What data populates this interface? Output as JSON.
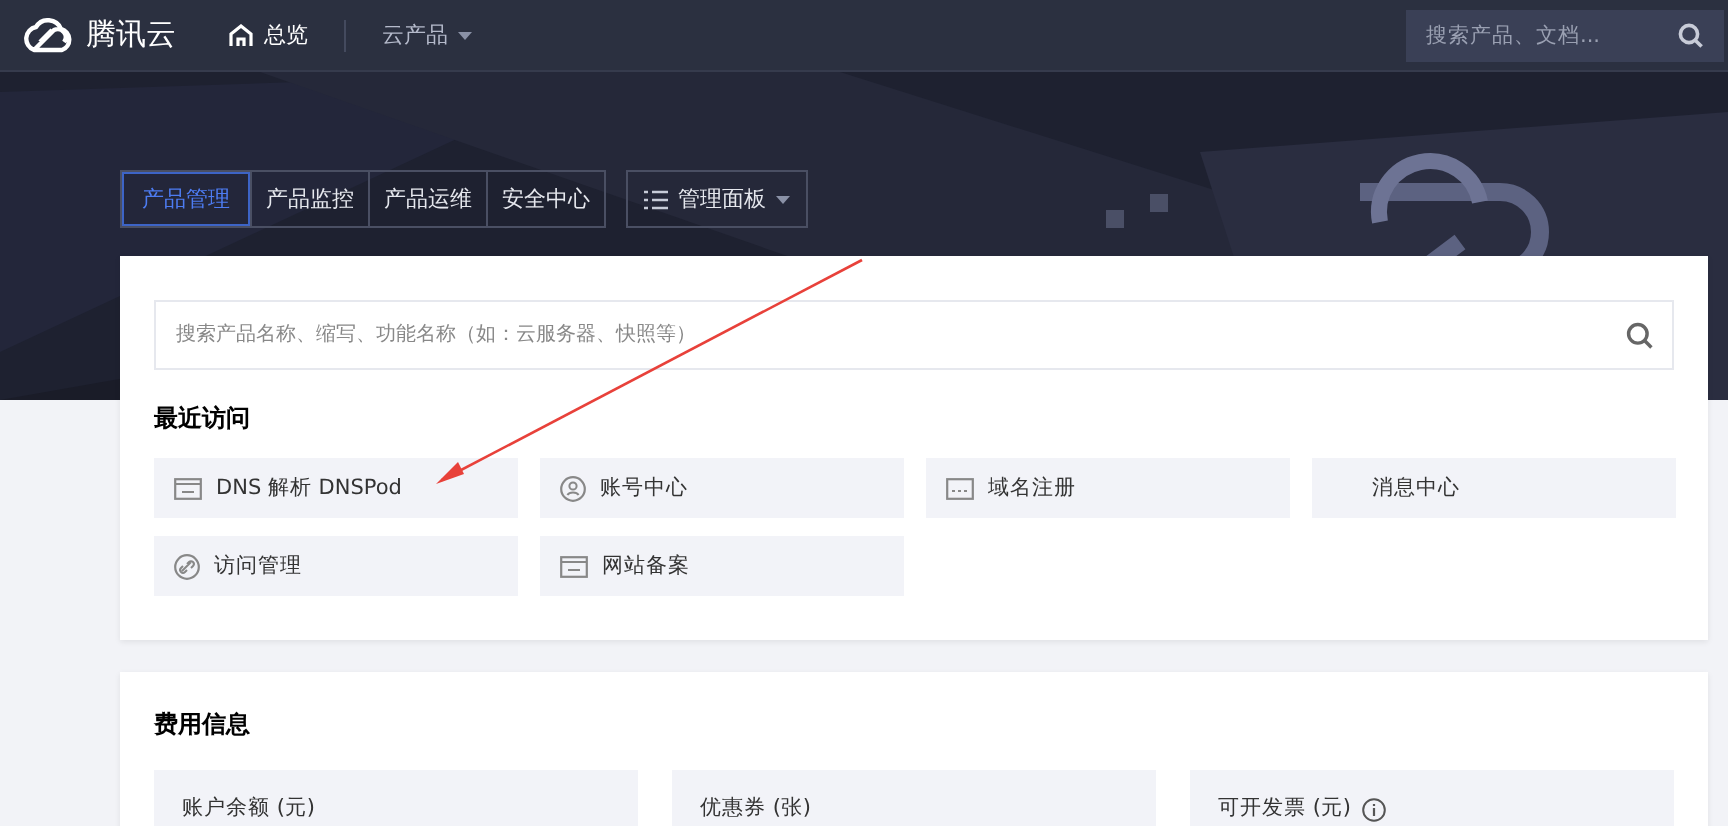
{
  "topbar": {
    "brand": "腾讯云",
    "nav": [
      {
        "label": "总览",
        "kind": "home"
      },
      {
        "label": "云产品",
        "kind": "dropdown"
      }
    ],
    "search": {
      "placeholder": "搜索产品、文档..."
    }
  },
  "hero": {
    "kind": "picture",
    "tabs": [
      {
        "label": "产品管理",
        "selected": true
      },
      {
        "label": "产品监控",
        "selected": false
      },
      {
        "label": "产品运维",
        "selected": false
      },
      {
        "label": "安全中心",
        "selected": false
      }
    ],
    "panel_button": "管理面板"
  },
  "recent": {
    "search": {
      "placeholder": "搜索产品名称、缩写、功能名称（如：云服务器、快照等）"
    },
    "title": "最近访问",
    "items": [
      {
        "label": "DNS 解析 DNSPod",
        "kind": "screen"
      },
      {
        "label": "账号中心",
        "kind": "user"
      },
      {
        "label": "域名注册",
        "kind": "domain"
      },
      {
        "label": "消息中心",
        "kind": "none"
      },
      {
        "label": "访问管理",
        "kind": "link"
      },
      {
        "label": "网站备案",
        "kind": "screen"
      }
    ]
  },
  "costs": {
    "title": "费用信息",
    "stats": [
      {
        "label": "账户余额 (元)",
        "info": false
      },
      {
        "label": "优惠券 (张)",
        "info": false
      },
      {
        "label": "可开发票 (元)",
        "info": true
      }
    ]
  },
  "annotation": {
    "kind": "arrow"
  }
}
